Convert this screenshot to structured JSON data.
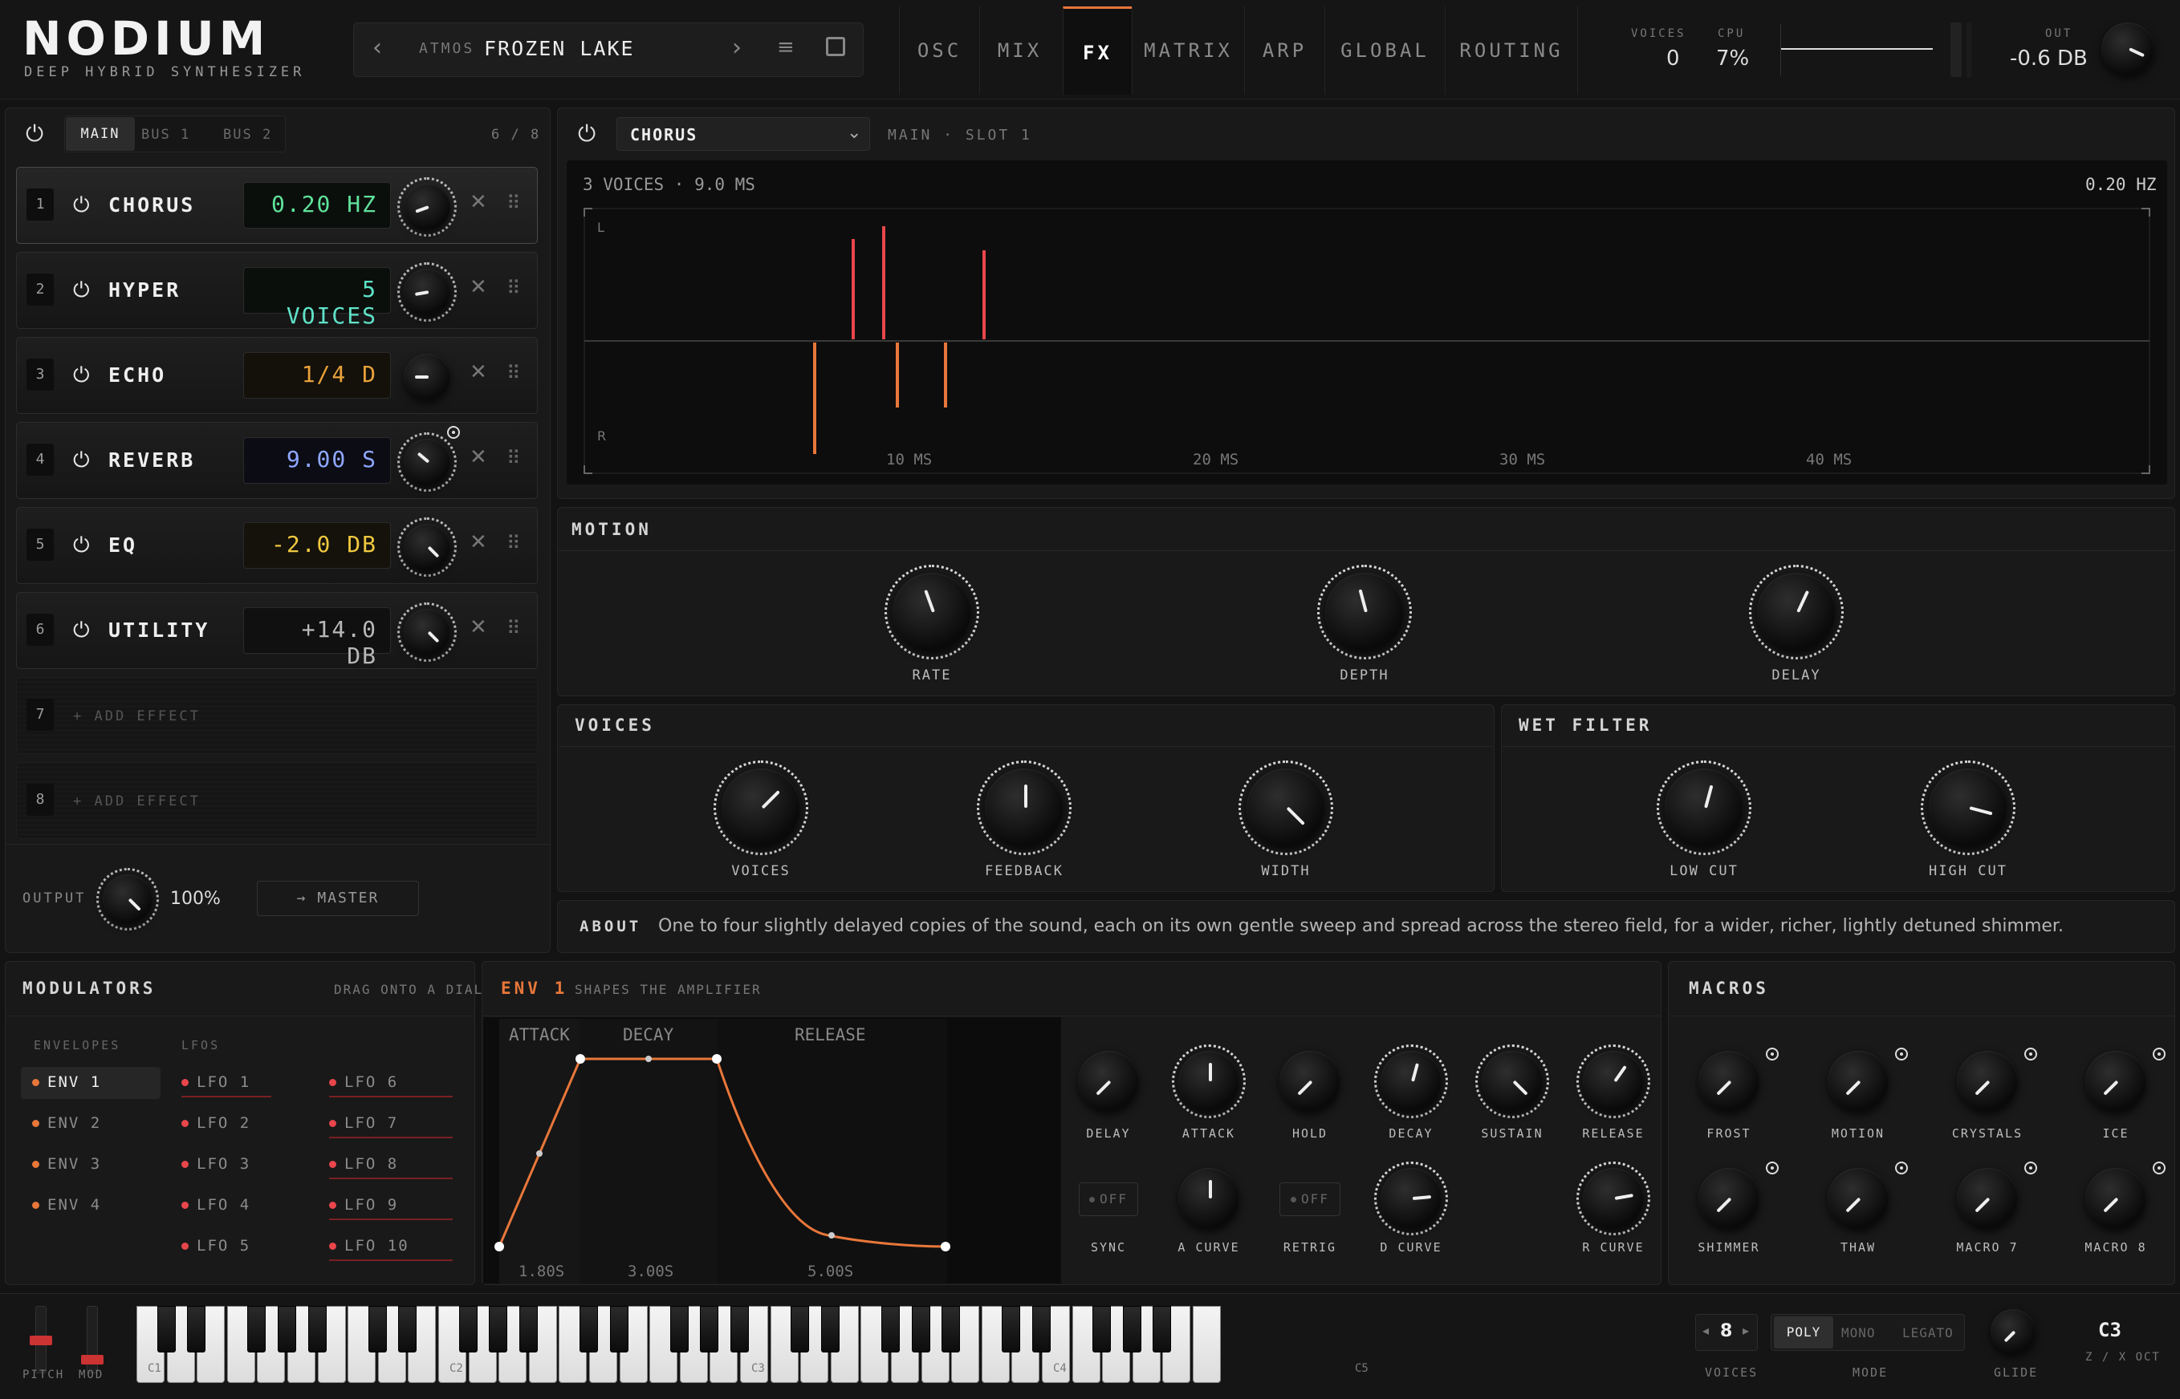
{
  "brand": {
    "logo": "NODIUM",
    "subtitle": "DEEP HYBRID SYNTHESIZER"
  },
  "preset": {
    "category": "ATMOS",
    "name": "FROZEN LAKE"
  },
  "tabs": [
    "OSC",
    "MIX",
    "FX",
    "MATRIX",
    "ARP",
    "GLOBAL",
    "ROUTING"
  ],
  "active_tab": "FX",
  "status": {
    "voices_label": "VOICES",
    "voices": "0",
    "cpu_label": "CPU",
    "cpu": "7%",
    "out_label": "OUT",
    "out": "-0.6 DB"
  },
  "fx_rack": {
    "bus_tabs": [
      "MAIN",
      "BUS 1",
      "BUS 2"
    ],
    "count": "6 / 8",
    "slots": [
      {
        "num": "1",
        "name": "CHORUS",
        "value": "0.20 HZ",
        "color": "#5fe39b"
      },
      {
        "num": "2",
        "name": "HYPER",
        "value": "5 VOICES",
        "color": "#5fe3c8"
      },
      {
        "num": "3",
        "name": "ECHO",
        "value": "1/4 D",
        "color": "#e8a23a"
      },
      {
        "num": "4",
        "name": "REVERB",
        "value": "9.00 S",
        "color": "#8fa8ff"
      },
      {
        "num": "5",
        "name": "EQ",
        "value": "-2.0 DB",
        "color": "#f0c840"
      },
      {
        "num": "6",
        "name": "UTILITY",
        "value": "+14.0 DB",
        "color": "#b8b8b8"
      }
    ],
    "empty": [
      {
        "num": "7",
        "label": "+ ADD EFFECT"
      },
      {
        "num": "8",
        "label": "+ ADD EFFECT"
      }
    ],
    "output_label": "OUTPUT",
    "output_value": "100%",
    "master_label": "→ MASTER"
  },
  "fx_editor": {
    "effect": "CHORUS",
    "slot_info": "MAIN · SLOT 1",
    "scope": {
      "info": "3 VOICES · 9.0 MS",
      "rate": "0.20 HZ",
      "left": "L",
      "right": "R",
      "ticks": [
        "10 MS",
        "20 MS",
        "30 MS",
        "40 MS"
      ]
    },
    "motion": {
      "title": "MOTION",
      "knobs": [
        "RATE",
        "DEPTH",
        "DELAY"
      ]
    },
    "voices": {
      "title": "VOICES",
      "knobs": [
        "VOICES",
        "FEEDBACK",
        "WIDTH"
      ]
    },
    "wet_filter": {
      "title": "WET FILTER",
      "knobs": [
        "LOW CUT",
        "HIGH CUT"
      ]
    },
    "about_label": "ABOUT",
    "about_text": "One to four slightly delayed copies of the sound, each on its own gentle sweep and spread across the stereo field, for a wider, richer, lightly detuned shimmer."
  },
  "modulators": {
    "title": "MODULATORS",
    "hint": "DRAG ONTO A DIAL",
    "envelopes_label": "ENVELOPES",
    "lfos_label": "LFOS",
    "envelopes": [
      "ENV 1",
      "ENV 2",
      "ENV 3",
      "ENV 4"
    ],
    "lfos_a": [
      "LFO 1",
      "LFO 2",
      "LFO 3",
      "LFO 4",
      "LFO 5"
    ],
    "lfos_b": [
      "LFO 6",
      "LFO 7",
      "LFO 8",
      "LFO 9",
      "LFO 10"
    ]
  },
  "envelope": {
    "title": "ENV 1",
    "subtitle": "SHAPES THE AMPLIFIER",
    "stages": [
      "ATTACK",
      "DECAY",
      "RELEASE"
    ],
    "times": [
      "1.80S",
      "3.00S",
      "5.00S"
    ],
    "knobs_top": [
      "DELAY",
      "ATTACK",
      "HOLD",
      "DECAY",
      "SUSTAIN",
      "RELEASE"
    ],
    "sync_label": "SYNC",
    "sync_state": "OFF",
    "acurve_label": "A CURVE",
    "retrig_label": "RETRIG",
    "retrig_state": "OFF",
    "dcurve_label": "D CURVE",
    "rcurve_label": "R CURVE"
  },
  "macros": {
    "title": "MACROS",
    "names": [
      "FROST",
      "MOTION",
      "CRYSTALS",
      "ICE",
      "SHIMMER",
      "THAW",
      "MACRO 7",
      "MACRO 8"
    ]
  },
  "keyboard": {
    "pitch_label": "PITCH",
    "mod_label": "MOD",
    "octave_labels": [
      "C1",
      "C2",
      "C3",
      "C4",
      "C5"
    ],
    "voices_value": "8",
    "voices_label": "VOICES",
    "modes": [
      "POLY",
      "MONO",
      "LEGATO"
    ],
    "active_mode": "POLY",
    "mode_label": "MODE",
    "glide_label": "GLIDE",
    "octave": "C3",
    "octave_hint": "Z / X OCT"
  },
  "colors": {
    "accent": "#e8773a",
    "red": "#e8464b",
    "panel": "#191919"
  }
}
